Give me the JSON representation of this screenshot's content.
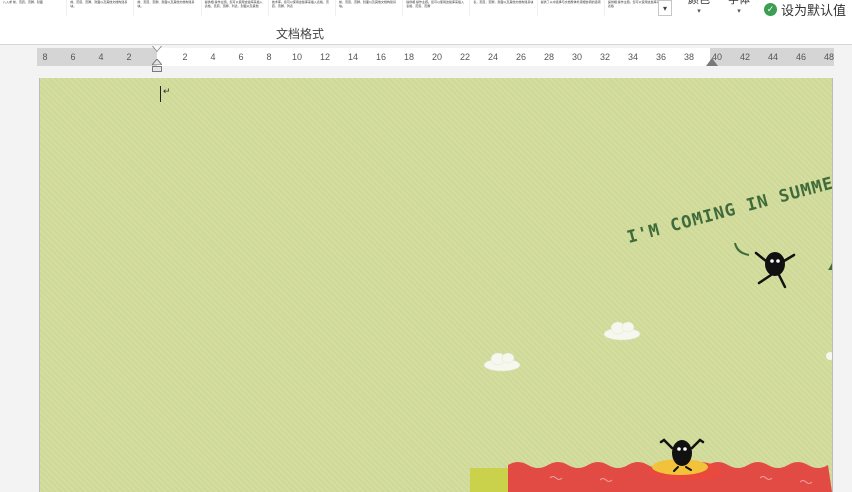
{
  "ribbon": {
    "gallery_snippets": [
      "八入求 前，页眉，页脚，封面",
      "前、页眉、页脚、封面以及其他文档构建基块。",
      "前、页眉、页脚、封面以及其他文档构建基块。",
      "提供相 操作主题。您可以使用这些库来插入表格、页眉、页脚、列表、封面以及其他",
      "技术库，您可以使用这些库来插入表格、页眉、页脚、列表",
      "前、页眉、页脚、封面以及其他文档构建基块。",
      "提供相 操作主题。您可以使用这些库来插入表格、页眉、页脚",
      "表，页眉，页脚，封面以及其他文档构建基块",
      "提供了从中选择与文档整体外观相协调的选项",
      "提供相 操作主题。您可以使用这些库来插入表格"
    ],
    "gallery_more": "▾",
    "btn1_label": "颜色",
    "btn2_label": "字体",
    "set_default_label": "设为默认值",
    "group_label": "文档格式"
  },
  "ruler": {
    "ticks": [
      "8",
      "6",
      "4",
      "2",
      "2",
      "4",
      "6",
      "8",
      "10",
      "12",
      "14",
      "16",
      "18",
      "20",
      "22",
      "24",
      "26",
      "28",
      "30",
      "32",
      "34",
      "36",
      "38",
      "40",
      "42",
      "44",
      "46",
      "48"
    ]
  },
  "document": {
    "paragraph_mark": "↵",
    "banner_text": "I'M COMING IN SUMMER"
  }
}
